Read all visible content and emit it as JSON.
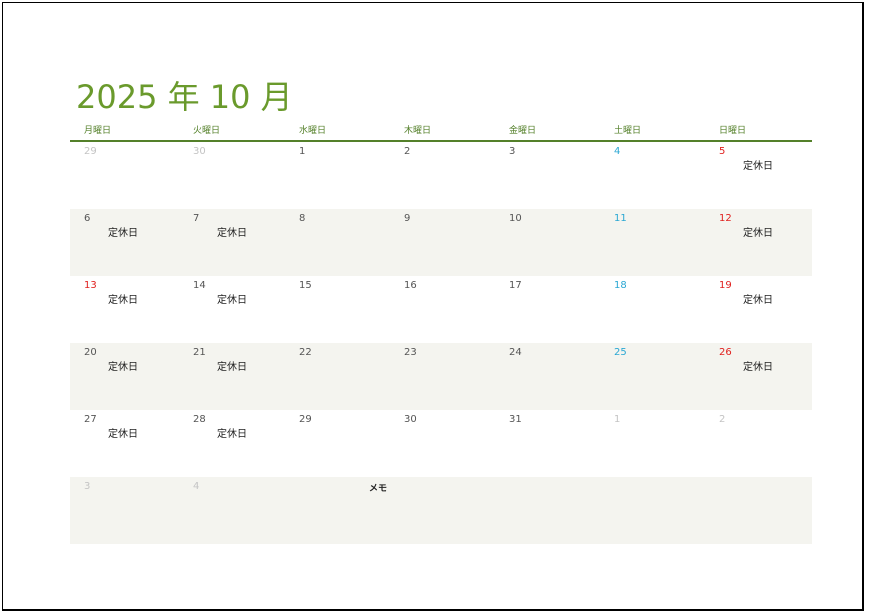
{
  "title": "2025 年 10 月",
  "weekdays": [
    "月曜日",
    "火曜日",
    "水曜日",
    "木曜日",
    "金曜日",
    "土曜日",
    "日曜日"
  ],
  "weeks": [
    [
      {
        "d": "29",
        "k": "other"
      },
      {
        "d": "30",
        "k": "other"
      },
      {
        "d": "1",
        "k": ""
      },
      {
        "d": "2",
        "k": ""
      },
      {
        "d": "3",
        "k": ""
      },
      {
        "d": "4",
        "k": "sat"
      },
      {
        "d": "5",
        "k": "sun",
        "note": "定休日"
      }
    ],
    [
      {
        "d": "6",
        "k": "",
        "note": "定休日"
      },
      {
        "d": "7",
        "k": "",
        "note": "定休日"
      },
      {
        "d": "8",
        "k": ""
      },
      {
        "d": "9",
        "k": ""
      },
      {
        "d": "10",
        "k": ""
      },
      {
        "d": "11",
        "k": "sat"
      },
      {
        "d": "12",
        "k": "sun",
        "note": "定休日"
      }
    ],
    [
      {
        "d": "13",
        "k": "sun",
        "note": "定休日"
      },
      {
        "d": "14",
        "k": "",
        "note": "定休日"
      },
      {
        "d": "15",
        "k": ""
      },
      {
        "d": "16",
        "k": ""
      },
      {
        "d": "17",
        "k": ""
      },
      {
        "d": "18",
        "k": "sat"
      },
      {
        "d": "19",
        "k": "sun",
        "note": "定休日"
      }
    ],
    [
      {
        "d": "20",
        "k": "",
        "note": "定休日"
      },
      {
        "d": "21",
        "k": "",
        "note": "定休日"
      },
      {
        "d": "22",
        "k": ""
      },
      {
        "d": "23",
        "k": ""
      },
      {
        "d": "24",
        "k": ""
      },
      {
        "d": "25",
        "k": "sat"
      },
      {
        "d": "26",
        "k": "sun",
        "note": "定休日"
      }
    ],
    [
      {
        "d": "27",
        "k": "",
        "note": "定休日"
      },
      {
        "d": "28",
        "k": "",
        "note": "定休日"
      },
      {
        "d": "29",
        "k": ""
      },
      {
        "d": "30",
        "k": ""
      },
      {
        "d": "31",
        "k": ""
      },
      {
        "d": "1",
        "k": "other"
      },
      {
        "d": "2",
        "k": "other"
      }
    ],
    [
      {
        "d": "3",
        "k": "other"
      },
      {
        "d": "4",
        "k": "other"
      }
    ]
  ],
  "memo_label": "メモ",
  "colors": {
    "title": "#6a9a2c",
    "header_rule": "#54802a",
    "saturday": "#2aa7d3",
    "sunday_holiday": "#e0201e",
    "other_month": "#c4c4c4",
    "row_shade": "#f4f4ef"
  }
}
